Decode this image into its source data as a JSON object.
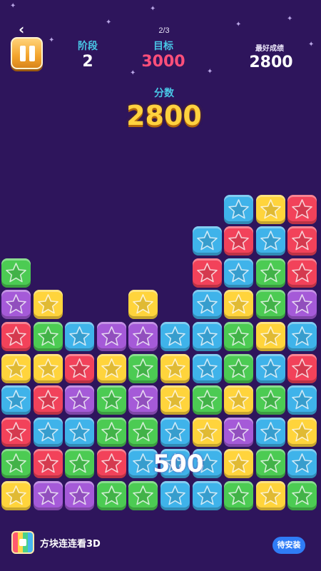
{
  "header": {
    "page_indicator": "2/3",
    "stage_label": "阶段",
    "stage_value": "2",
    "target_label": "目标",
    "target_value": "3000",
    "best_label": "最好成绩",
    "best_value": "2800",
    "score_label": "分数",
    "score_value": "2800"
  },
  "colors": {
    "background": "#2e155c",
    "stat_label": "#49c7e6",
    "stage_value": "#ffffff",
    "target_value": "#ff4f7a",
    "best_value": "#ffffff",
    "score_value": "#ffd23f",
    "install_button": "#2f7cf6"
  },
  "icons": {
    "back": "chevron-left-icon",
    "pause": "pause-icon",
    "block": "star-icon"
  },
  "board": {
    "columns": 10,
    "palette": {
      "blue": "#3fb3ea",
      "yellow": "#ffd43c",
      "red": "#f2425a",
      "green": "#4ccb53",
      "purple": "#a55ad8"
    },
    "columns_bottom_up": [
      [
        "yellow",
        "green",
        "red",
        "blue",
        "yellow",
        "red",
        "purple",
        "green"
      ],
      [
        "purple",
        "red",
        "blue",
        "red",
        "yellow",
        "green",
        "yellow"
      ],
      [
        "purple",
        "green",
        "blue",
        "purple",
        "red",
        "blue"
      ],
      [
        "green",
        "red",
        "green",
        "green",
        "yellow",
        "purple"
      ],
      [
        "green",
        "blue",
        "green",
        "purple",
        "green",
        "purple",
        "yellow"
      ],
      [
        "blue",
        "blue",
        "blue",
        "yellow",
        "yellow",
        "blue"
      ],
      [
        "blue",
        "blue",
        "yellow",
        "green",
        "blue",
        "blue",
        "blue",
        "red",
        "blue"
      ],
      [
        "green",
        "yellow",
        "purple",
        "yellow",
        "green",
        "green",
        "yellow",
        "blue",
        "red",
        "blue"
      ],
      [
        "yellow",
        "green",
        "blue",
        "green",
        "blue",
        "yellow",
        "green",
        "green",
        "blue",
        "yellow"
      ],
      [
        "green",
        "blue",
        "yellow",
        "blue",
        "red",
        "blue",
        "purple",
        "red",
        "red",
        "red"
      ]
    ],
    "floating_score": "500"
  },
  "ad": {
    "title": "方块连连看3D",
    "install_label": "待安装"
  }
}
